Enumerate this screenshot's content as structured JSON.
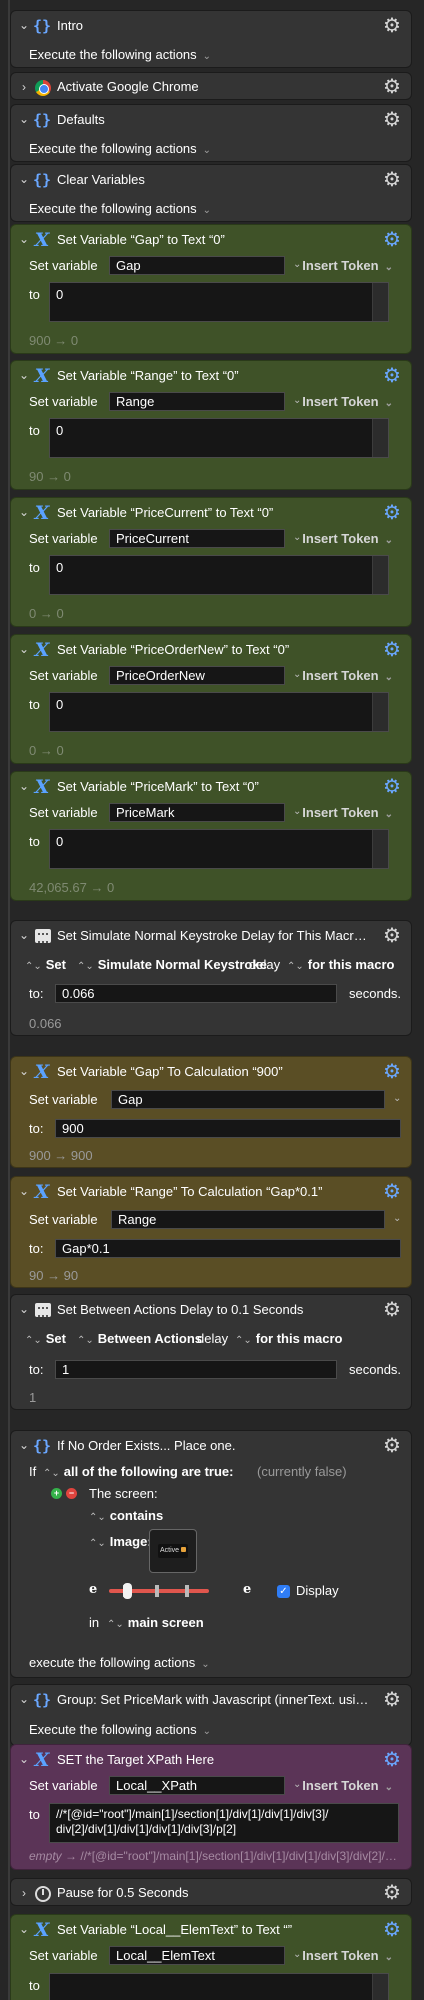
{
  "icons": {
    "gear": "gear-icon",
    "brace": "group-braces-icon",
    "variable": "variable-x-icon"
  },
  "colors": {
    "green": "#3f5228",
    "olive": "#5a4e25",
    "purple": "#5b3457",
    "accent": "#5aa2ff"
  },
  "actions": [
    {
      "title": "Intro",
      "sub": "Execute the following actions"
    },
    {
      "title": "Activate Google Chrome"
    },
    {
      "title": "Defaults",
      "sub": "Execute the following actions"
    },
    {
      "title": "Clear Variables",
      "sub": "Execute the following actions"
    },
    {
      "title": "Set Variable “Gap” to Text “0”",
      "set_label": "Set variable",
      "var": "Gap",
      "token": "Insert Token",
      "to": "to",
      "value": "0",
      "result": "900 → 0"
    },
    {
      "title": "Set Variable “Range” to Text “0”",
      "set_label": "Set variable",
      "var": "Range",
      "token": "Insert Token",
      "to": "to",
      "value": "0",
      "result": "90 → 0"
    },
    {
      "title": "Set Variable “PriceCurrent” to Text “0”",
      "set_label": "Set variable",
      "var": "PriceCurrent",
      "token": "Insert Token",
      "to": "to",
      "value": "0",
      "result": "0 → 0"
    },
    {
      "title": "Set Variable “PriceOrderNew” to Text “0”",
      "set_label": "Set variable",
      "var": "PriceOrderNew",
      "token": "Insert Token",
      "to": "to",
      "value": "0",
      "result": "0 → 0"
    },
    {
      "title": "Set Variable “PriceMark” to Text “0”",
      "set_label": "Set variable",
      "var": "PriceMark",
      "token": "Insert Token",
      "to": "to",
      "value": "0",
      "result": "42,065.67 → 0"
    },
    {
      "title": "Set Simulate Normal Keystroke Delay for This Macro to 0.066 Seconds",
      "set": "Set",
      "what": "Simulate Normal Keystroke",
      "delay": "delay",
      "scope": "for this macro",
      "to": "to:",
      "value": "0.066",
      "unit": "seconds.",
      "result": "0.066"
    },
    {
      "title": "Set Variable “Gap” To Calculation “900”",
      "set_label": "Set variable",
      "var": "Gap",
      "to": "to:",
      "value": "900",
      "result": "900 → 900"
    },
    {
      "title": "Set Variable “Range” To Calculation “Gap*0.1”",
      "set_label": "Set variable",
      "var": "Range",
      "to": "to:",
      "value": "Gap*0.1",
      "result": "90 → 90"
    },
    {
      "title": "Set Between Actions Delay to 0.1 Seconds",
      "set": "Set",
      "what": "Between Actions",
      "delay": "delay",
      "scope": "for this macro",
      "to": "to:",
      "value": "1",
      "unit": "seconds.",
      "result": "1"
    },
    {
      "title": "If No Order Exists... Place one.",
      "if_label": "If",
      "cond": "all of the following are true:",
      "state": "(currently false)",
      "screen": "The screen:",
      "contains": "contains",
      "image": "Image:",
      "thumb_text": "Active",
      "slider_value": 0.15,
      "e": "e",
      "display": "Display",
      "in": "in",
      "where": "main screen",
      "sub": "execute the following actions"
    },
    {
      "title": "Group: Set PriceMark with Javascript (innerText. using XPath)",
      "sub": "Execute the following actions"
    },
    {
      "title": "SET the Target XPath Here",
      "set_label": "Set variable",
      "var": "Local__XPath",
      "token": "Insert Token",
      "to": "to",
      "value_l1": "//*[@id=\"root\"]/main[1]/section[1]/div[1]/div[1]/div[3]/",
      "value_l2": "div[2]/div[1]/div[1]/div[1]/div[3]/p[2]",
      "result_empty": "empty",
      "result_rest": " → //*[@id=\"root\"]/main[1]/section[1]/div[1]/div[1]/div[3]/div[2]/div[1]/div[1]/div[1]/div[3]/p[2]"
    },
    {
      "title": "Pause for 0.5 Seconds"
    },
    {
      "title": "Set Variable “Local__ElemText” to Text “”",
      "set_label": "Set variable",
      "var": "Local__ElemText",
      "token": "Insert Token",
      "to": "to"
    }
  ]
}
